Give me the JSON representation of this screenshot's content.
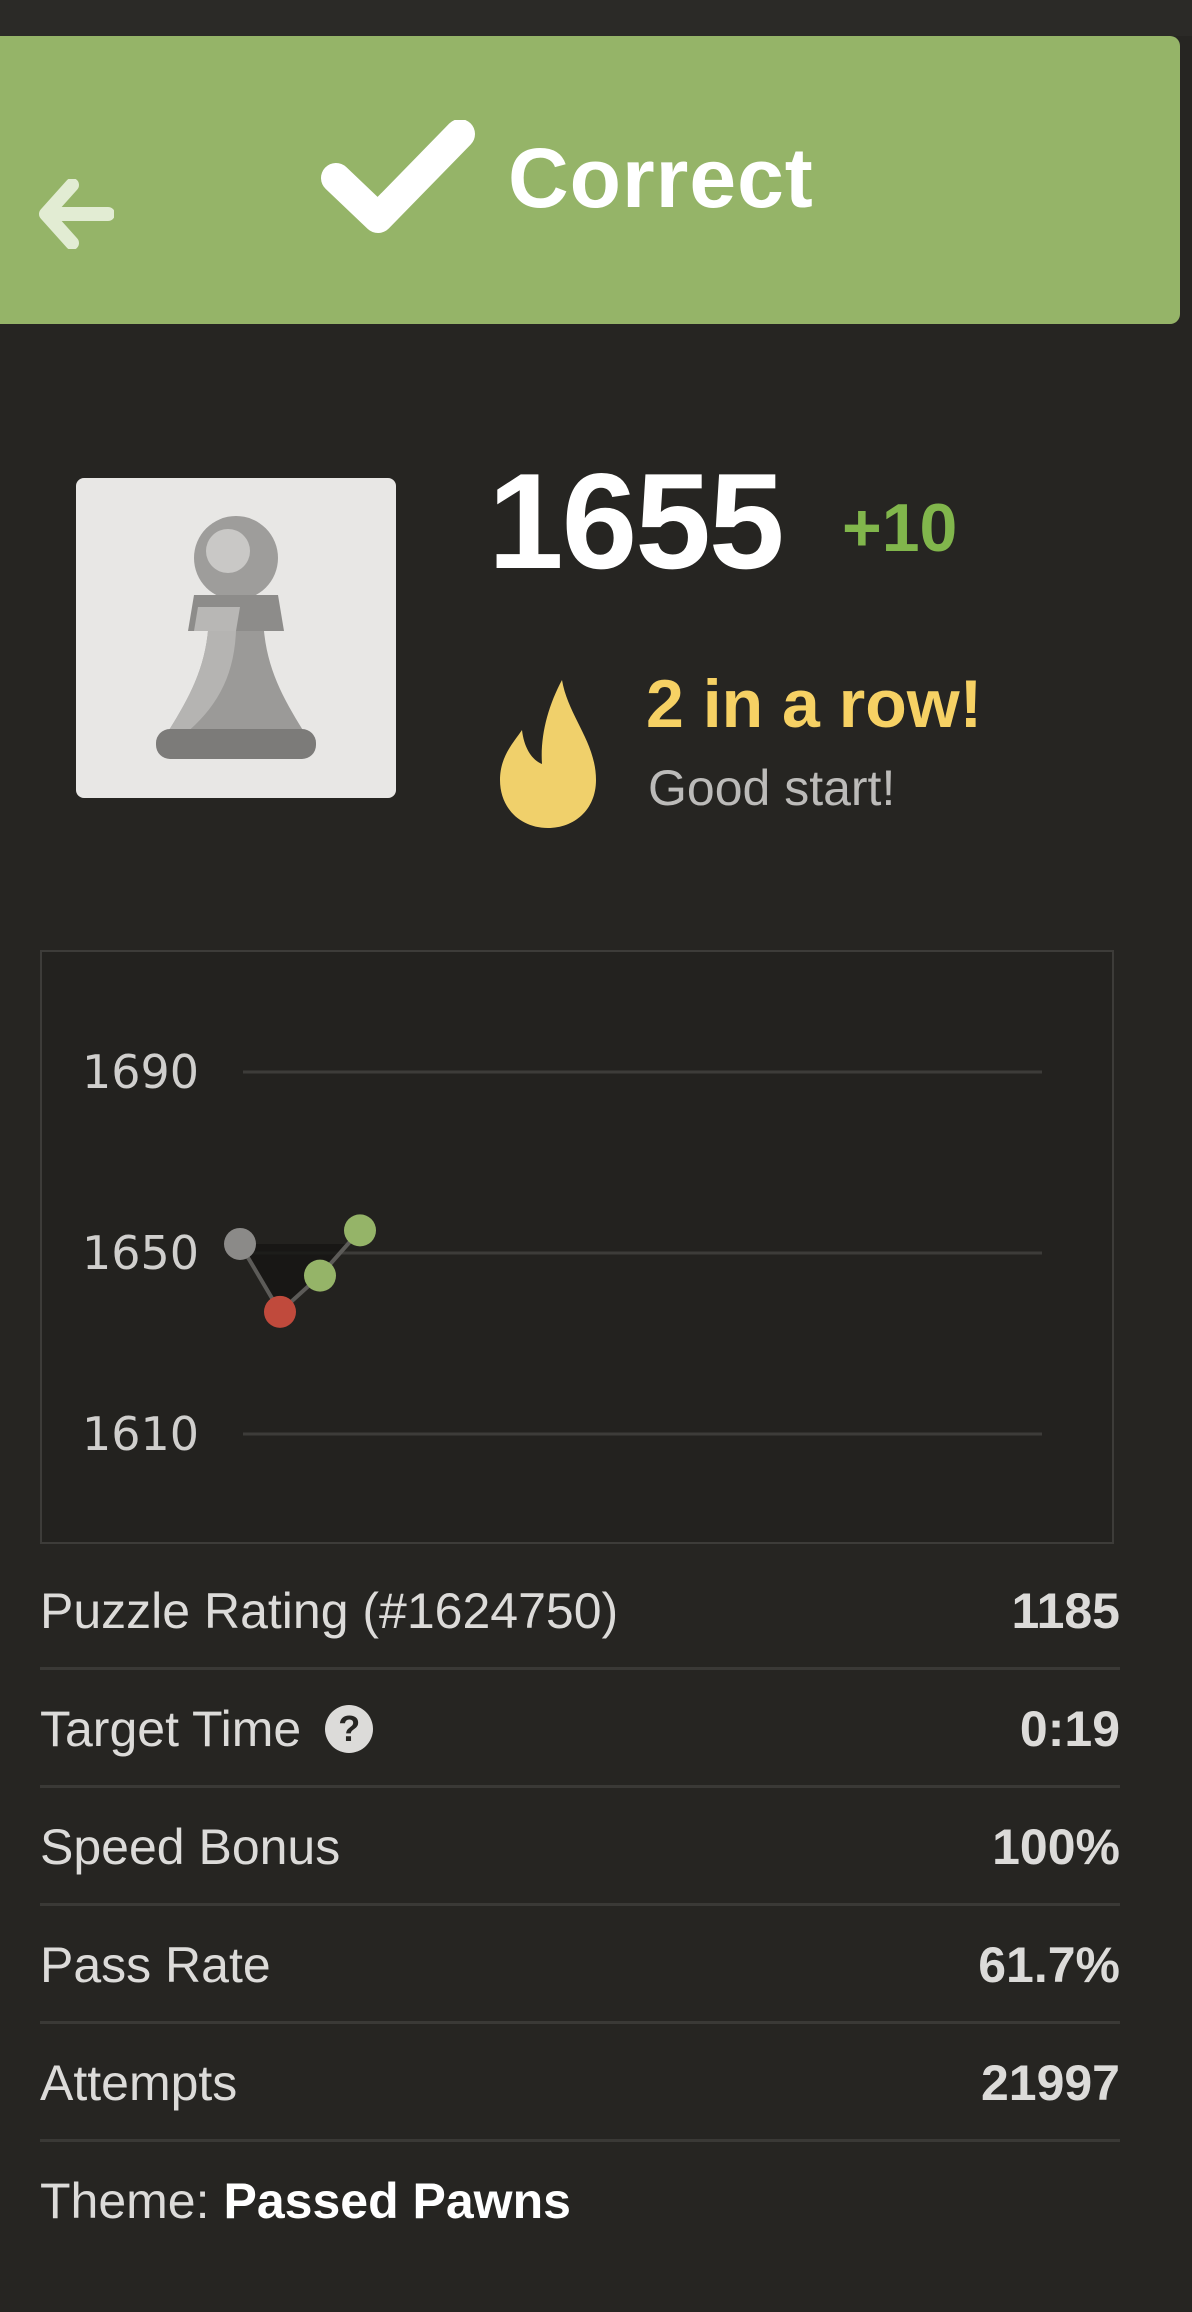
{
  "header": {
    "title": "Correct",
    "back_icon": "arrow-left-icon",
    "status_icon": "checkmark-icon",
    "background": "#95b468"
  },
  "player": {
    "avatar_icon": "pawn-icon",
    "rating": "1655",
    "delta": "+10",
    "delta_color": "#81b64c"
  },
  "streak": {
    "icon": "flame-icon",
    "title": "2 in a row!",
    "subtitle": "Good start!",
    "color": "#f6d164"
  },
  "chart_data": {
    "type": "line",
    "y_ticks": [
      "1690",
      "1650",
      "1610"
    ],
    "ylim": [
      1610,
      1690
    ],
    "grid": true,
    "points": [
      {
        "x": 1,
        "y": 1652,
        "result": "start",
        "color": "#8b8a88"
      },
      {
        "x": 2,
        "y": 1637,
        "result": "fail",
        "color": "#c04a3c"
      },
      {
        "x": 3,
        "y": 1645,
        "result": "pass",
        "color": "#95b468"
      },
      {
        "x": 4,
        "y": 1655,
        "result": "pass",
        "color": "#95b468"
      }
    ]
  },
  "stats": {
    "rows": [
      {
        "label": "Puzzle Rating (#1624750)",
        "value": "1185"
      },
      {
        "label": "Target Time",
        "value": "0:19",
        "help": "?"
      },
      {
        "label": "Speed Bonus",
        "value": "100%"
      },
      {
        "label": "Pass Rate",
        "value": "61.7%"
      },
      {
        "label": "Attempts",
        "value": "21997"
      }
    ],
    "theme_label": "Theme:",
    "theme_value": "Passed Pawns"
  }
}
